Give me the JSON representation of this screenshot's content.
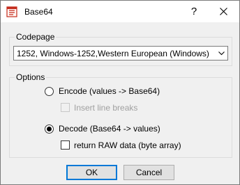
{
  "window": {
    "title": "Base64",
    "help_label": "?",
    "close_icon": "close-icon"
  },
  "codepage": {
    "group_label": "Codepage",
    "selected": "1252, Windows-1252,Western European (Windows)"
  },
  "options": {
    "group_label": "Options",
    "encode_label": "Encode (values -> Base64)",
    "encode_selected": false,
    "line_breaks_label": "Insert line breaks",
    "line_breaks_enabled": false,
    "line_breaks_checked": false,
    "decode_label": "Decode (Base64 -> values)",
    "decode_selected": true,
    "raw_label": "return RAW data (byte array)",
    "raw_checked": false
  },
  "buttons": {
    "ok_label": "OK",
    "cancel_label": "Cancel"
  },
  "colors": {
    "focus_accent": "#0078d7",
    "app_icon_red": "#c42b1c"
  }
}
